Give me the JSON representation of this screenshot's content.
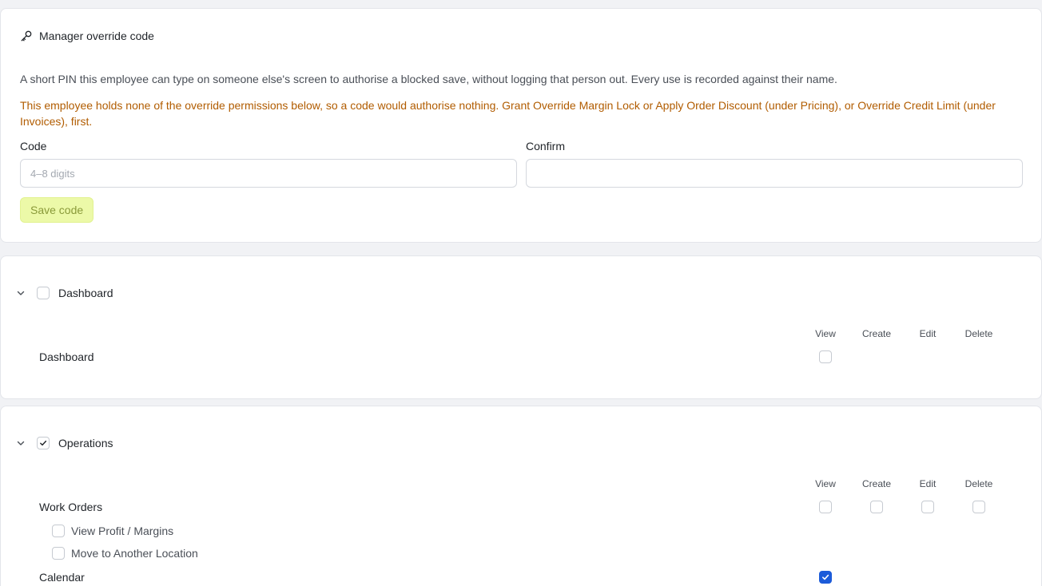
{
  "override": {
    "title": "Manager override code",
    "icon": "key-icon",
    "description": "A short PIN this employee can type on someone else's screen to authorise a blocked save, without logging that person out. Every use is recorded against their name.",
    "warning": "This employee holds none of the override permissions below, so a code would authorise nothing. Grant Override Margin Lock or Apply Order Discount (under Pricing), or Override Credit Limit (under Invoices), first.",
    "code_label": "Code",
    "code_placeholder": "4–8 digits",
    "code_value": "",
    "confirm_label": "Confirm",
    "confirm_value": "",
    "save_label": "Save code"
  },
  "columns": [
    "View",
    "Create",
    "Edit",
    "Delete"
  ],
  "dashboard": {
    "title": "Dashboard",
    "checked": false,
    "rows": [
      {
        "label": "Dashboard",
        "view": false
      }
    ]
  },
  "operations": {
    "title": "Operations",
    "checked": true,
    "rows": [
      {
        "label": "Work Orders",
        "view": false,
        "create": false,
        "edit": false,
        "delete": false
      },
      {
        "label": "Calendar",
        "view": true
      }
    ],
    "sub_options": [
      {
        "label": "View Profit / Margins",
        "checked": false
      },
      {
        "label": "Move to Another Location",
        "checked": false
      }
    ]
  },
  "colors": {
    "accent": "#1c5bd9",
    "warning": "#b15c00",
    "save_button_bg": "#ecf9a8"
  }
}
